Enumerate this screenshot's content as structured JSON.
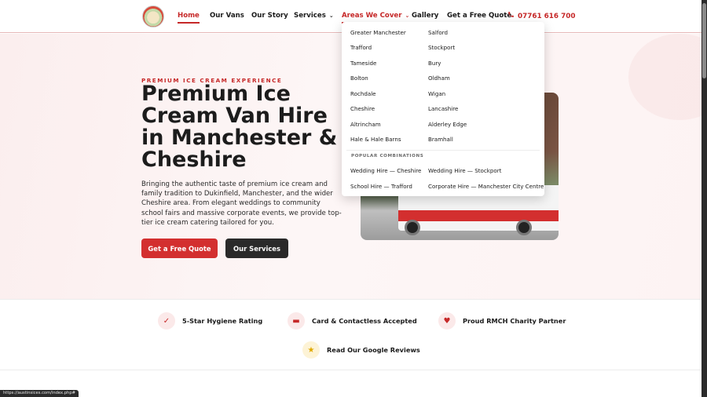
{
  "header": {
    "logo_alt": "Austin's Ices logo",
    "nav": [
      {
        "label": "Home",
        "active": true
      },
      {
        "label": "Our Vans"
      },
      {
        "label": "Our Story"
      },
      {
        "label": "Services"
      },
      {
        "label": "Areas We Cover"
      },
      {
        "label": "Gallery"
      },
      {
        "label": "Get a Free Quote"
      }
    ],
    "chevron": "⌄",
    "phone": "07761 616 700",
    "phone_icon": "phone-icon"
  },
  "hero": {
    "eyebrow": "PREMIUM ICE CREAM EXPERIENCE",
    "title": "Premium Ice Cream Van Hire in Manchester & Cheshire",
    "description": "Bringing the authentic taste of premium ice cream and family tradition to Dukinfield, Manchester, and the wider Cheshire area. From elegant weddings to community school fairs and massive corporate events, we provide top-tier ice cream catering tailored for you.",
    "btn_quote": "Get a Free Quote",
    "btn_services": "Our Services"
  },
  "dropdown": {
    "left": [
      "Greater Manchester",
      "Trafford",
      "Tameside",
      "Bolton",
      "Rochdale",
      "Cheshire",
      "Altrincham",
      "Hale & Hale Barns"
    ],
    "right": [
      "Salford",
      "Stockport",
      "Bury",
      "Oldham",
      "Wigan",
      "Lancashire",
      "Alderley Edge",
      "Bramhall"
    ],
    "combos_heading": "POPULAR COMBINATIONS",
    "combos": [
      "Wedding Hire — Cheshire",
      "Wedding Hire — Stockport",
      "School Hire — Trafford",
      "Corporate Hire — Manchester City Centre"
    ]
  },
  "trust": [
    {
      "label": "5-Star Hygiene Rating",
      "icon": "check-circle-icon",
      "glyph": "✓",
      "color": "#c62828"
    },
    {
      "label": "Card & Contactless Accepted",
      "icon": "credit-card-icon",
      "glyph": "▬",
      "color": "#c62828"
    },
    {
      "label": "Proud RMCH Charity Partner",
      "icon": "heart-icon",
      "glyph": "♥",
      "color": "#c62828"
    },
    {
      "label": "Read Our Google Reviews",
      "icon": "star-icon",
      "glyph": "★",
      "color": "#e0a800"
    }
  ],
  "status_url": "https://austinsices.com/index.php#"
}
